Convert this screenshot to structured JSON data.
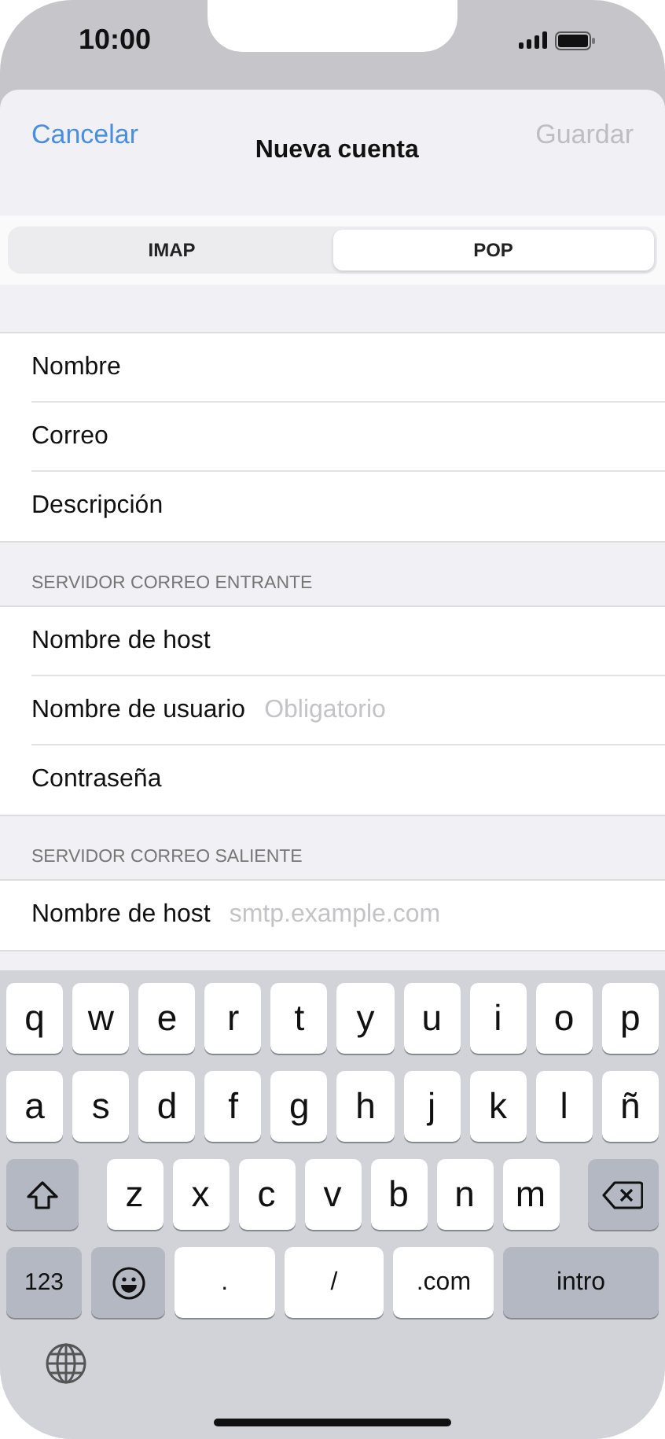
{
  "status_bar": {
    "time": "10:00"
  },
  "nav": {
    "cancel": "Cancelar",
    "title": "Nueva cuenta",
    "save": "Guardar",
    "save_disabled": true
  },
  "tabs": [
    {
      "label": "IMAP",
      "selected": false
    },
    {
      "label": "POP",
      "selected": true
    }
  ],
  "sections": [
    {
      "fields": [
        {
          "label": "Nombre"
        },
        {
          "label": "Correo"
        },
        {
          "label": "Descripción"
        }
      ]
    },
    {
      "header": "SERVIDOR CORREO ENTRANTE",
      "fields": [
        {
          "label": "Nombre de host"
        },
        {
          "label": "Nombre de usuario",
          "placeholder": "Obligatorio"
        },
        {
          "label": "Contraseña"
        }
      ]
    },
    {
      "header": "SERVIDOR CORREO SALIENTE",
      "fields": [
        {
          "label": "Nombre de host",
          "placeholder": "smtp.example.com"
        }
      ]
    }
  ],
  "keyboard": {
    "key_rows": [
      {
        "keys": [
          {
            "kind": "letter",
            "label": "q"
          },
          {
            "kind": "letter",
            "label": "w"
          },
          {
            "kind": "letter",
            "label": "e"
          },
          {
            "kind": "letter",
            "label": "r"
          },
          {
            "kind": "letter",
            "label": "t"
          },
          {
            "kind": "letter",
            "label": "y"
          },
          {
            "kind": "letter",
            "label": "u"
          },
          {
            "kind": "letter",
            "label": "i"
          },
          {
            "kind": "letter",
            "label": "o"
          },
          {
            "kind": "letter",
            "label": "p"
          }
        ]
      },
      {
        "keys": [
          {
            "kind": "letter",
            "label": "a"
          },
          {
            "kind": "letter",
            "label": "s"
          },
          {
            "kind": "letter",
            "label": "d"
          },
          {
            "kind": "letter",
            "label": "f"
          },
          {
            "kind": "letter",
            "label": "g"
          },
          {
            "kind": "letter",
            "label": "h"
          },
          {
            "kind": "letter",
            "label": "j"
          },
          {
            "kind": "letter",
            "label": "k"
          },
          {
            "kind": "letter",
            "label": "l"
          },
          {
            "kind": "letter",
            "label": "ñ"
          }
        ]
      },
      {
        "keys": [
          {
            "kind": "shift"
          },
          {
            "kind": "letter",
            "label": "z"
          },
          {
            "kind": "letter",
            "label": "x"
          },
          {
            "kind": "letter",
            "label": "c"
          },
          {
            "kind": "letter",
            "label": "v"
          },
          {
            "kind": "letter",
            "label": "b"
          },
          {
            "kind": "letter",
            "label": "n"
          },
          {
            "kind": "letter",
            "label": "m"
          },
          {
            "kind": "delete"
          }
        ]
      },
      {
        "keys": [
          {
            "kind": "numbers",
            "label": "123"
          },
          {
            "kind": "emoji"
          },
          {
            "kind": "wide",
            "label": "."
          },
          {
            "kind": "wide",
            "label": "/"
          },
          {
            "kind": "wide",
            "label": ".com"
          },
          {
            "kind": "return",
            "label": "intro"
          }
        ]
      }
    ]
  }
}
